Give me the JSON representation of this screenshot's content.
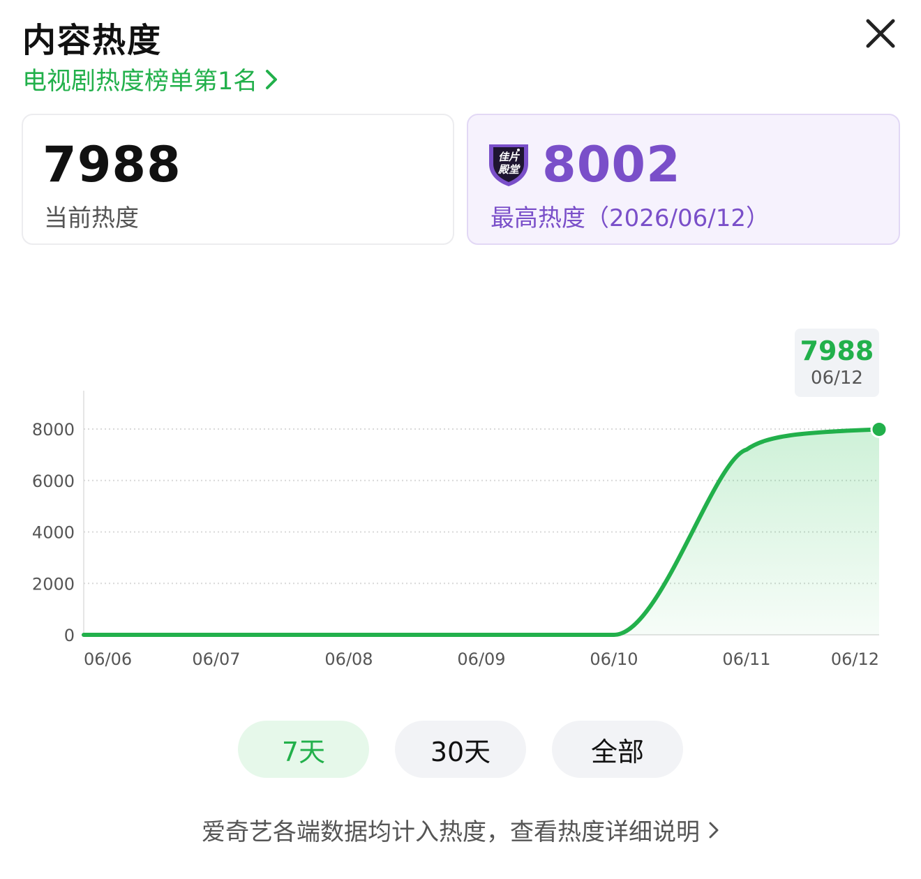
{
  "header": {
    "title": "内容热度",
    "rank_link": "电视剧热度榜单第1名"
  },
  "current": {
    "value": "7988",
    "label": "当前热度"
  },
  "peak": {
    "value": "8002",
    "label": "最高热度（2026/06/12）",
    "badge_line1": "佳片",
    "badge_line2": "殿堂"
  },
  "tooltip": {
    "value": "7988",
    "date": "06/12"
  },
  "colors": {
    "green": "#22b04b",
    "purple": "#7a4fc9"
  },
  "chart_data": {
    "type": "area",
    "categories": [
      "06/06",
      "06/07",
      "06/08",
      "06/09",
      "06/10",
      "06/11",
      "06/12"
    ],
    "values": [
      0,
      0,
      0,
      0,
      0,
      7200,
      7988
    ],
    "yticks": [
      0,
      2000,
      4000,
      6000,
      8000
    ],
    "ylim": [
      0,
      8000
    ],
    "grid": true
  },
  "ranges": [
    {
      "label": "7天",
      "active": true
    },
    {
      "label": "30天",
      "active": false
    },
    {
      "label": "全部",
      "active": false
    }
  ],
  "footer": {
    "text": "爱奇艺各端数据均计入热度，查看热度详细说明"
  }
}
